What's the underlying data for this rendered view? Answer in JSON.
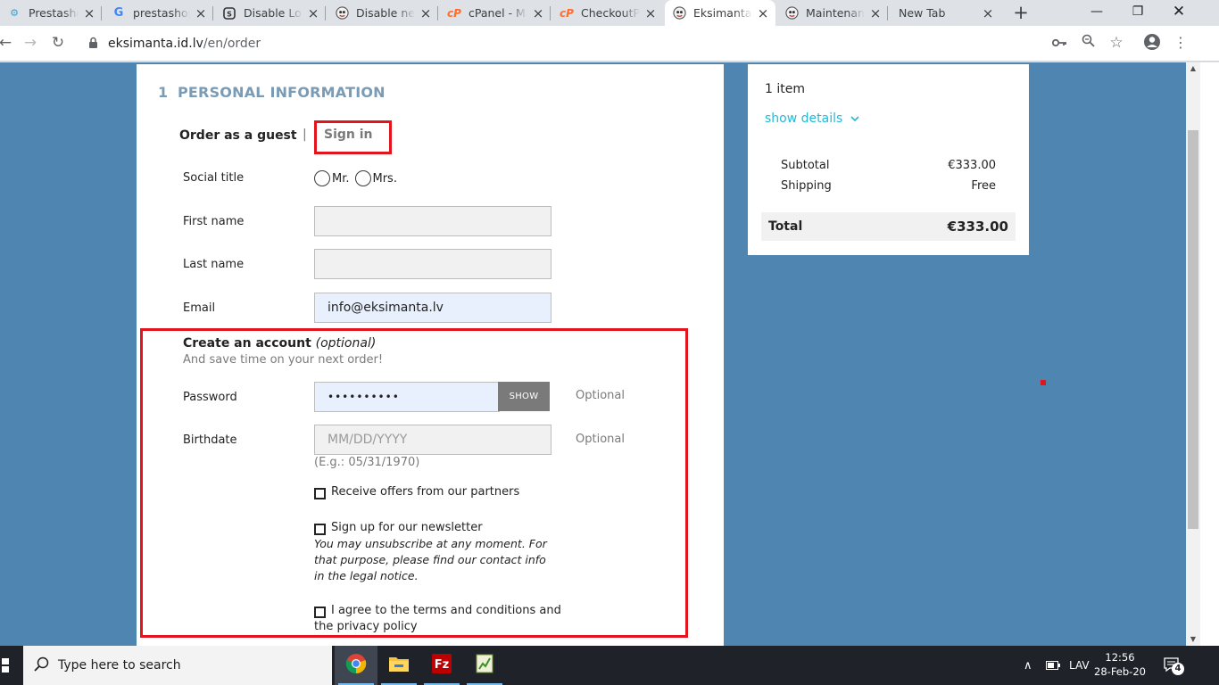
{
  "browser": {
    "tabs": [
      {
        "title": "Prestashop",
        "favicon": "gears-icon"
      },
      {
        "title": "prestashop",
        "favicon": "google-icon"
      },
      {
        "title": "Disable Log",
        "favicon": "blog-icon"
      },
      {
        "title": "Disable new",
        "favicon": "prestashop-icon"
      },
      {
        "title": "cPanel - Ma",
        "favicon": "cpanel-icon"
      },
      {
        "title": "CheckoutPe",
        "favicon": "cpanel-icon"
      },
      {
        "title": "Eksimanta.l",
        "favicon": "prestashop-icon",
        "active": true
      },
      {
        "title": "Maintenanc",
        "favicon": "prestashop-icon"
      },
      {
        "title": "New Tab",
        "favicon": ""
      }
    ],
    "url_host": "eksimanta.id.lv",
    "url_path": "/en/order"
  },
  "checkout": {
    "step_number": "1",
    "step_title": "PERSONAL INFORMATION",
    "order_as_guest": "Order as a guest",
    "nav_separator": "|",
    "sign_in": "Sign in",
    "labels": {
      "social_title": "Social title",
      "first_name": "First name",
      "last_name": "Last name",
      "email": "Email",
      "password": "Password",
      "birthdate": "Birthdate"
    },
    "social_options": [
      "Mr.",
      "Mrs."
    ],
    "values": {
      "first_name": "",
      "last_name": "",
      "email": "info@eksimanta.lv",
      "password_mask": "••••••••••"
    },
    "birthdate_placeholder": "MM/DD/YYYY",
    "birthdate_hint": "(E.g.: 05/31/1970)",
    "show_button": "SHOW",
    "optional": "Optional",
    "create_account_title": "Create an account",
    "create_account_optional": "(optional)",
    "create_account_sub": "And save time on your next order!",
    "checkboxes": {
      "partners": "Receive offers from our partners",
      "newsletter": "Sign up for our newsletter",
      "newsletter_note": "You may unsubscribe at any moment. For that purpose, please find our contact info in the legal notice.",
      "terms_line1": "I agree to the terms and conditions and",
      "terms_line2": "the privacy policy"
    }
  },
  "summary": {
    "items": "1 item",
    "show_details": "show details",
    "subtotal_label": "Subtotal",
    "subtotal_value": "€333.00",
    "shipping_label": "Shipping",
    "shipping_value": "Free",
    "total_label": "Total",
    "total_value": "€333.00"
  },
  "taskbar": {
    "search_placeholder": "Type here to search",
    "language": "LAV",
    "time": "12:56",
    "date": "28-Feb-20",
    "notification_count": "4"
  },
  "colors": {
    "page_background": "#4f86b1",
    "highlight_red": "#e2141c",
    "link_cyan": "#24b9d7"
  }
}
